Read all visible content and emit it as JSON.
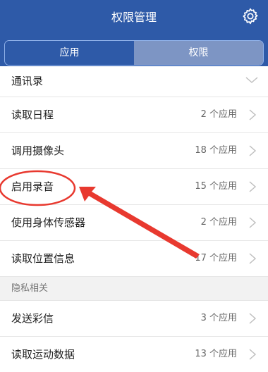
{
  "header": {
    "title": "权限管理",
    "settings_icon": "gear-icon"
  },
  "tabs": [
    {
      "label": "应用",
      "selected": false
    },
    {
      "label": "权限",
      "selected": true
    }
  ],
  "rows_top": [
    {
      "label": "通讯录",
      "count": ""
    },
    {
      "label": "读取日程",
      "count": "2 个应用"
    },
    {
      "label": "调用摄像头",
      "count": "18 个应用"
    },
    {
      "label": "启用录音",
      "count": "15 个应用"
    },
    {
      "label": "使用身体传感器",
      "count": "2 个应用"
    },
    {
      "label": "读取位置信息",
      "count": "17 个应用"
    }
  ],
  "section_label": "隐私相关",
  "rows_privacy": [
    {
      "label": "发送彩信",
      "count": "3 个应用"
    },
    {
      "label": "读取运动数据",
      "count": "13 个应用"
    }
  ],
  "annotation_color": "#e8392f"
}
